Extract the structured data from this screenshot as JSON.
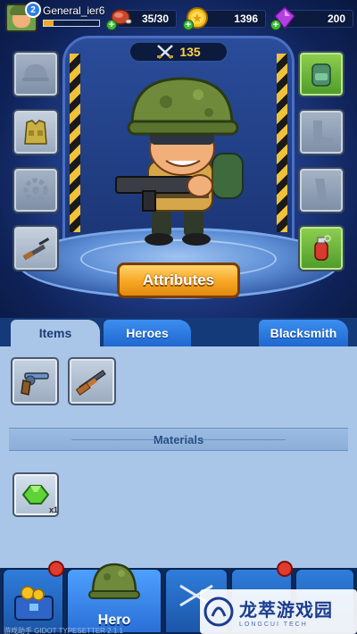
{
  "player": {
    "name": "General_ier6",
    "level": "2",
    "xp_progress": 0.18
  },
  "resources": {
    "stamina": {
      "value": "35/30",
      "icon": "meat-icon"
    },
    "gold": {
      "value": "1396",
      "icon": "gold-coin-icon"
    },
    "gems": {
      "value": "200",
      "icon": "purple-gem-icon"
    },
    "add_label": "+"
  },
  "hero": {
    "power": "135",
    "power_icon": "crossed-swords-icon"
  },
  "equipment_slots": {
    "left": [
      "helmet-slot-empty",
      "armor-vest-slot",
      "gear-slot-empty",
      "rifle-slot"
    ],
    "right": [
      "backpack-slot",
      "boots-slot-empty",
      "magazine-slot-empty",
      "grenade-slot"
    ]
  },
  "attributes_button": "Attributes",
  "tabs": [
    {
      "label": "Items",
      "active": true
    },
    {
      "label": "Heroes",
      "active": false
    },
    {
      "label": "Blacksmith",
      "active": false
    }
  ],
  "items": [
    "revolver",
    "shotgun"
  ],
  "materials": {
    "title": "Materials",
    "items": [
      {
        "name": "green-gem",
        "count": "x1"
      }
    ]
  },
  "bottom_nav": {
    "hero_label": "Hero"
  },
  "watermark": {
    "title": "龙萃游戏园",
    "subtitle": "LONGCUI TECH"
  },
  "footer": "游戏助手 GIDOT TYPESETTER 2.1.1"
}
